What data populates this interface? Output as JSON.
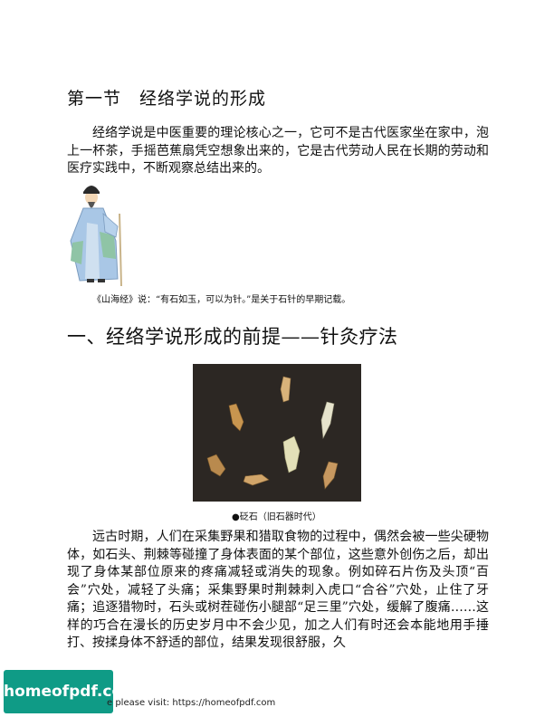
{
  "section_title": "第一节　经络学说的形成",
  "intro_paragraph": "经络学说是中医重要的理论核心之一，它可不是古代医家坐在家中，泡上一杯茶，手摇芭蕉扇凭空想象出来的，它是古代劳动人民在长期的劳动和医疗实践中，不断观察总结出来的。",
  "figure1_caption": "《山海经》说：“有石如玉，可以为针。”是关于石针的早期记载。",
  "subsection_title": "一、经络学说形成的前提——针灸疗法",
  "figure2_caption": "●砭石（旧石器时代）",
  "body_paragraph": "远古时期，人们在采集野果和猎取食物的过程中，偶然会被一些尖硬物体，如石头、荆棘等碰撞了身体表面的某个部位，这些意外创伤之后，却出现了身体某部位原来的疼痛减轻或消失的现象。例如碎石片伤及头顶“百会”穴处，减轻了头痛；采集野果时荆棘刺入虎口“合谷”穴处，止住了牙痛；追逐猎物时，石头或树茬碰伤小腿部“足三里”穴处，缓解了腹痛……这样的巧合在漫长的历史岁月中不会少见，加之人们有时还会本能地用手捶打、按揉身体不舒适的部位，结果发现很舒服，久",
  "watermark": {
    "logo_text": "homeofpdf.com",
    "footer_text": "e please visit: https://homeofpdf.com"
  }
}
